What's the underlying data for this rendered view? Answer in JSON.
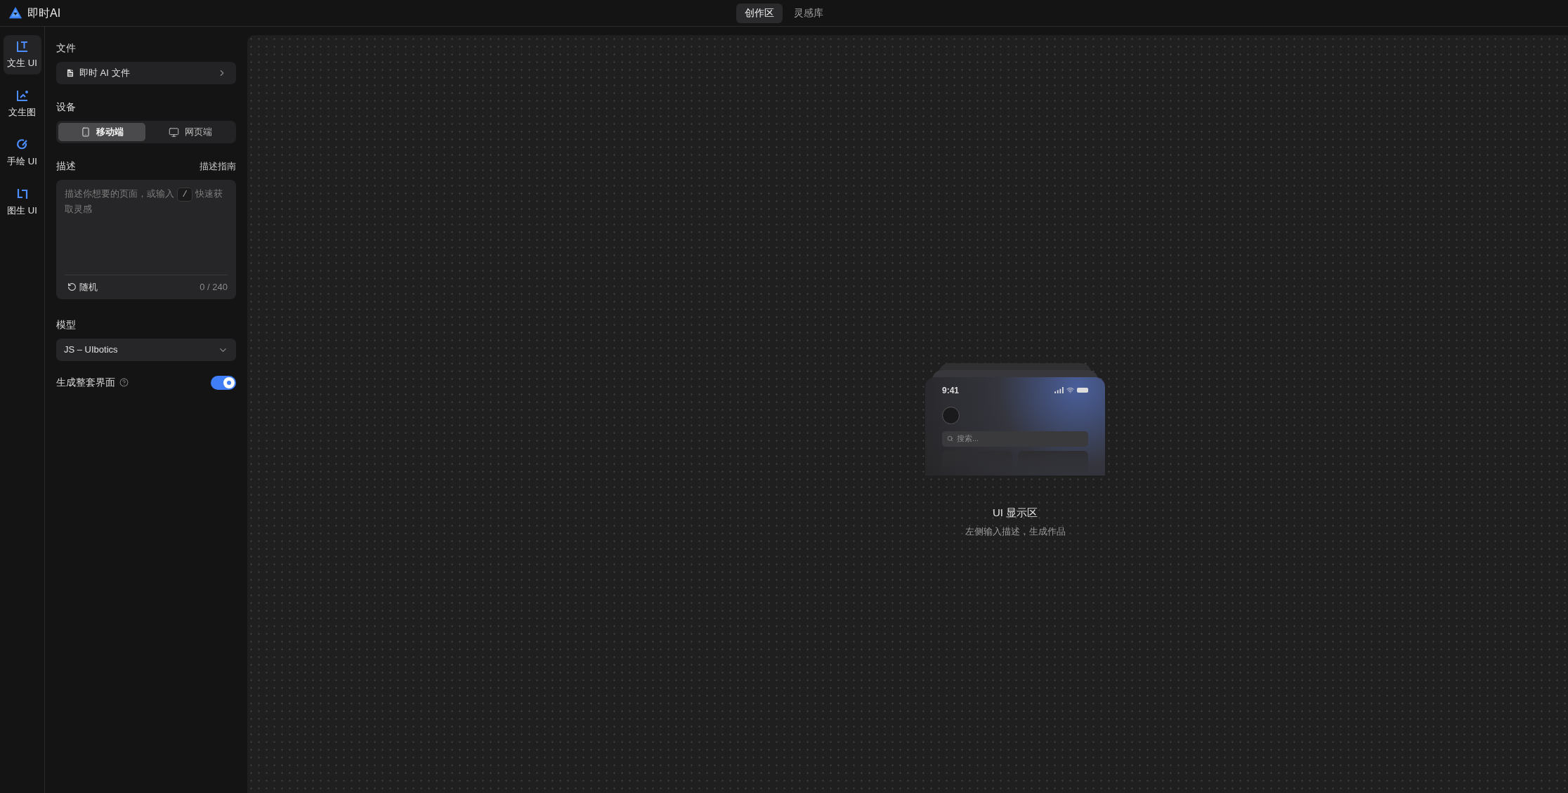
{
  "app": {
    "name": "即时AI"
  },
  "top_tabs": [
    {
      "label": "创作区",
      "selected": true
    },
    {
      "label": "灵感库",
      "selected": false
    }
  ],
  "rail": [
    {
      "kind": "text-ui",
      "label": "文生 UI",
      "selected": true
    },
    {
      "kind": "text-image",
      "label": "文生图",
      "selected": false
    },
    {
      "kind": "sketch-ui",
      "label": "手绘 UI",
      "selected": false
    },
    {
      "kind": "image-ui",
      "label": "图生 UI",
      "selected": false
    }
  ],
  "file": {
    "label": "文件",
    "value": "即时 AI 文件"
  },
  "device": {
    "label": "设备",
    "options": [
      {
        "kind": "mobile",
        "label": "移动端",
        "selected": true
      },
      {
        "kind": "desktop",
        "label": "网页端",
        "selected": false
      }
    ]
  },
  "description": {
    "label": "描述",
    "guide_link": "描述指南",
    "placeholder_before": "描述你想要的页面，或输入",
    "key": "/",
    "placeholder_after": "快速获取灵感",
    "random_button": "随机",
    "counter": "0 / 240"
  },
  "model": {
    "label": "模型",
    "value": "JS – UIbotics"
  },
  "full_set": {
    "label": "生成整套界面",
    "on": true
  },
  "preview": {
    "time": "9:41",
    "search_placeholder": "搜索...",
    "title": "UI 显示区",
    "subtitle": "左侧输入描述，生成作品"
  }
}
